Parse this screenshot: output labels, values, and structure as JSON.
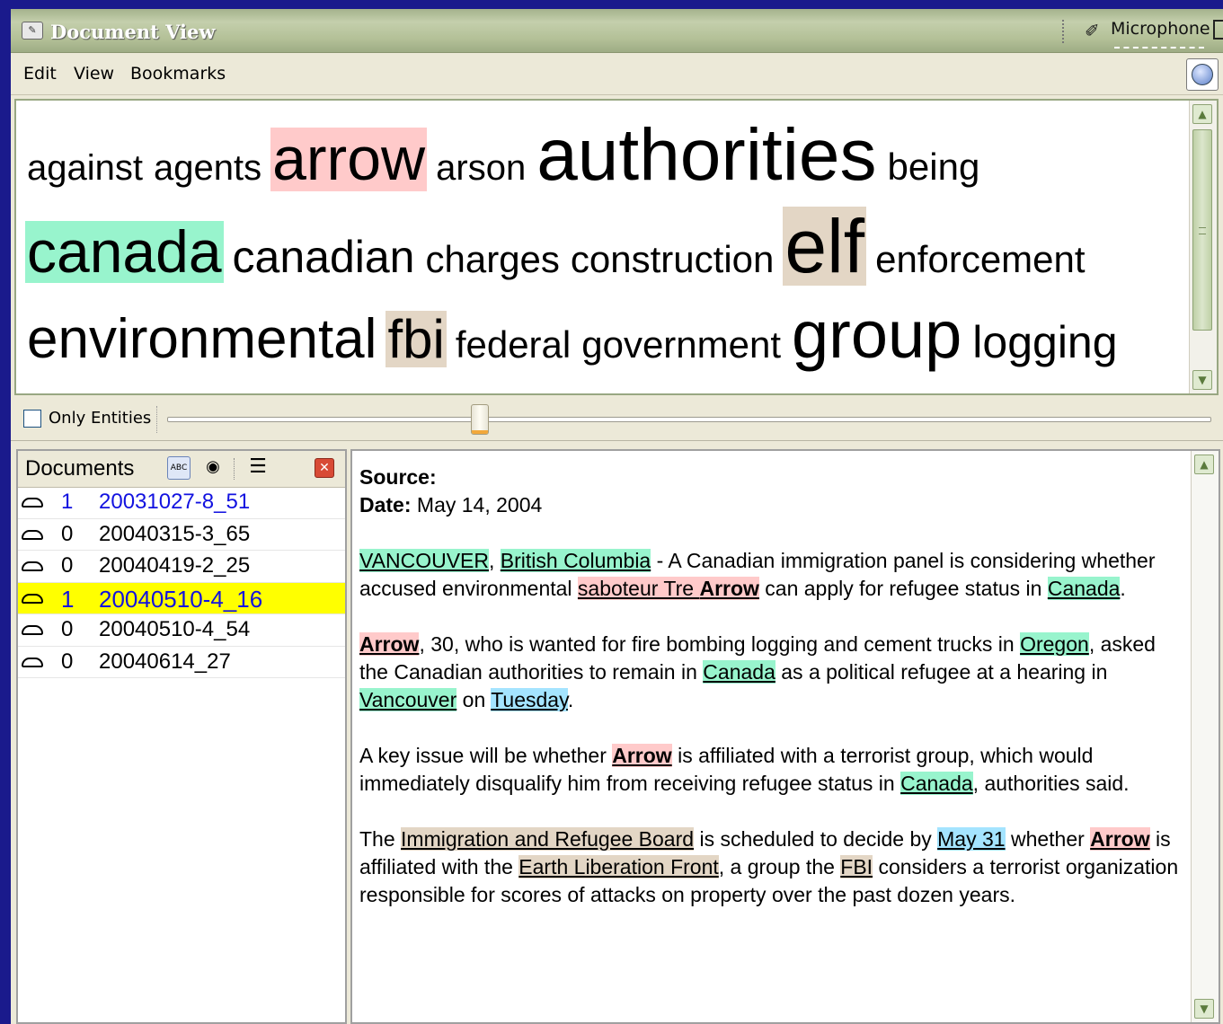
{
  "window": {
    "title": "Document View",
    "microphone_label": "Microphone"
  },
  "menu": [
    "Edit",
    "View",
    "Bookmarks"
  ],
  "word_cloud": {
    "rows": [
      [
        {
          "text": "against",
          "size": 40,
          "hl": ""
        },
        {
          "text": "agents",
          "size": 40,
          "hl": ""
        },
        {
          "text": "arrow",
          "size": 68,
          "hl": "red"
        },
        {
          "text": "arson",
          "size": 40,
          "hl": ""
        },
        {
          "text": "authorities",
          "size": 82,
          "hl": ""
        },
        {
          "text": "being",
          "size": 42,
          "hl": ""
        }
      ],
      [
        {
          "text": "canada",
          "size": 66,
          "hl": "green"
        },
        {
          "text": "canadian",
          "size": 50,
          "hl": ""
        },
        {
          "text": "charges",
          "size": 42,
          "hl": ""
        },
        {
          "text": "construction",
          "size": 42,
          "hl": ""
        },
        {
          "text": "elf",
          "size": 84,
          "hl": "tan"
        },
        {
          "text": "enforcement",
          "size": 42,
          "hl": ""
        }
      ],
      [
        {
          "text": "environmental",
          "size": 62,
          "hl": ""
        },
        {
          "text": "fbi",
          "size": 60,
          "hl": "tan"
        },
        {
          "text": "federal",
          "size": 42,
          "hl": ""
        },
        {
          "text": "government",
          "size": 42,
          "hl": ""
        },
        {
          "text": "group",
          "size": 74,
          "hl": ""
        },
        {
          "text": "logging",
          "size": 50,
          "hl": ""
        }
      ]
    ]
  },
  "filter": {
    "only_entities_label": "Only Entities",
    "only_entities_checked": false,
    "slider_value": 0.3
  },
  "documents": {
    "title": "Documents",
    "items": [
      {
        "count": "1",
        "id": "20031027-8_51",
        "style": "blue"
      },
      {
        "count": "0",
        "id": "20040315-3_65",
        "style": ""
      },
      {
        "count": "0",
        "id": "20040419-2_25",
        "style": ""
      },
      {
        "count": "1",
        "id": "20040510-4_16",
        "style": "selected"
      },
      {
        "count": "0",
        "id": "20040510-4_54",
        "style": ""
      },
      {
        "count": "0",
        "id": "20040614_27",
        "style": ""
      }
    ]
  },
  "article": {
    "source_label": "Source:",
    "source_value": "",
    "date_label": "Date:",
    "date_value": " May 14, 2004",
    "paragraphs": [
      [
        {
          "t": "VANCOUVER",
          "e": "green"
        },
        {
          "t": ", "
        },
        {
          "t": "British Columbia",
          "e": "green"
        },
        {
          "t": " - A Canadian immigration panel is considering whether accused environmental "
        },
        {
          "t": "saboteur Tre ",
          "e": "red"
        },
        {
          "t": "Arrow",
          "e": "red",
          "b": true
        },
        {
          "t": " can apply for refugee status in "
        },
        {
          "t": "Canada",
          "e": "green"
        },
        {
          "t": "."
        }
      ],
      [
        {
          "t": "Arrow",
          "e": "red",
          "b": true
        },
        {
          "t": ", 30, who is wanted for fire bombing logging and cement trucks in "
        },
        {
          "t": "Oregon",
          "e": "green"
        },
        {
          "t": ", asked the Canadian authorities to remain in "
        },
        {
          "t": "Canada",
          "e": "green"
        },
        {
          "t": " as a political refugee at a hearing in "
        },
        {
          "t": "Vancouver",
          "e": "green"
        },
        {
          "t": " on "
        },
        {
          "t": "Tuesday",
          "e": "blue"
        },
        {
          "t": "."
        }
      ],
      [
        {
          "t": "A key issue will be whether "
        },
        {
          "t": "Arrow",
          "e": "red",
          "b": true
        },
        {
          "t": " is affiliated with a terrorist group, which would immediately disqualify him from receiving refugee status in "
        },
        {
          "t": "Canada",
          "e": "green"
        },
        {
          "t": ", authorities said."
        }
      ],
      [
        {
          "t": "The "
        },
        {
          "t": "Immigration and Refugee Board",
          "e": "tan"
        },
        {
          "t": " is scheduled to decide by "
        },
        {
          "t": "May 31",
          "e": "blue"
        },
        {
          "t": " whether "
        },
        {
          "t": "Arrow",
          "e": "red",
          "b": true
        },
        {
          "t": " is affiliated with the "
        },
        {
          "t": "Earth Liberation Front",
          "e": "tan"
        },
        {
          "t": ", a group the "
        },
        {
          "t": "FBI",
          "e": "tan"
        },
        {
          "t": " considers a terrorist organization responsible for scores of attacks on property over the past dozen years."
        }
      ]
    ]
  },
  "colors": {
    "frame": "#1a1a8c",
    "highlight_red": "#ffcaca",
    "highlight_green": "#98f4cd",
    "highlight_tan": "#e3d6c5",
    "highlight_blue": "#a4e4ff",
    "selected_row": "#ffff00",
    "link_blue": "#1212e0"
  }
}
